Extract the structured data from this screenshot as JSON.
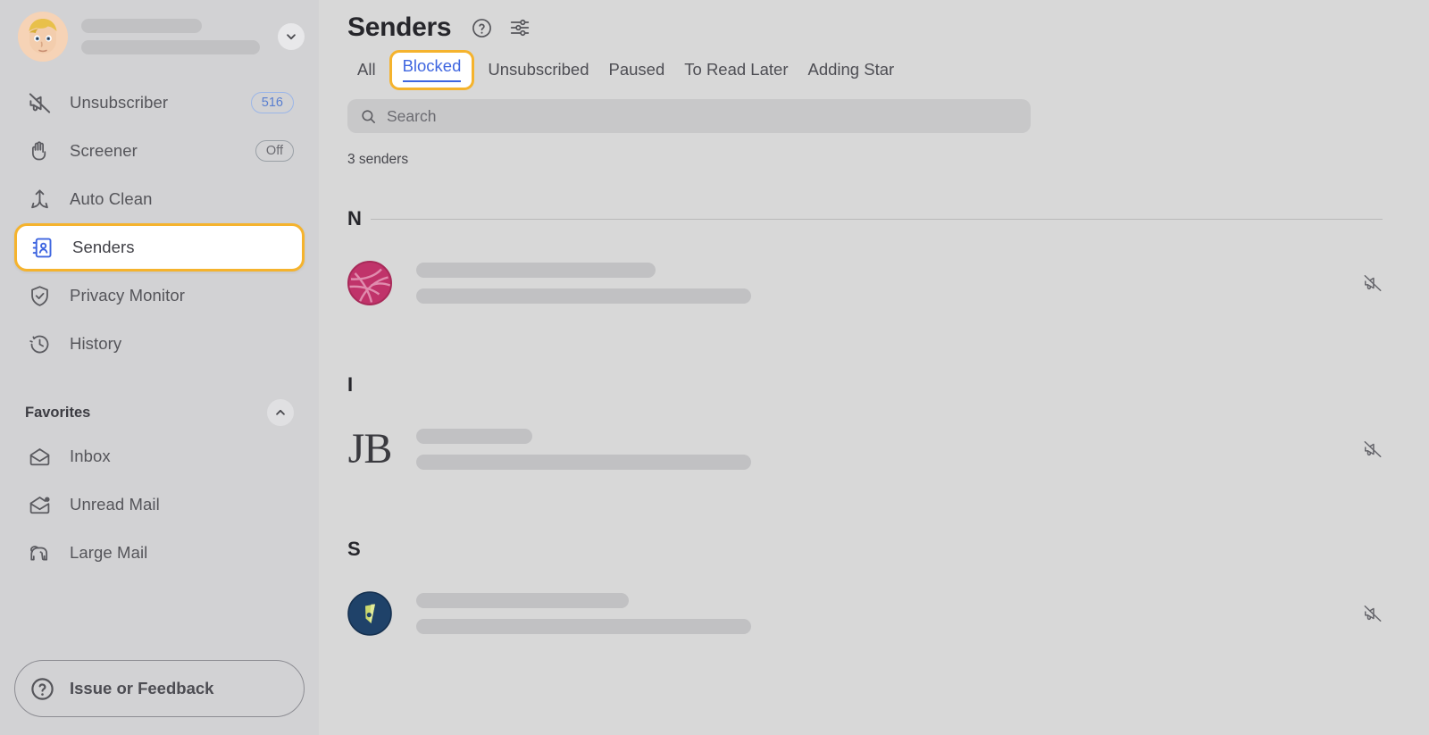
{
  "sidebar": {
    "account": {
      "name_redacted": true,
      "email_redacted": true,
      "avatar_icon": "memoji-avatar",
      "expand_icon": "chevron-down-icon"
    },
    "nav_items": [
      {
        "label": "Unsubscriber",
        "icon": "megaphone-slash-icon",
        "badge": "516",
        "badge_style": "blue",
        "active": false
      },
      {
        "label": "Screener",
        "icon": "hand-raised-icon",
        "badge": "Off",
        "badge_style": "gray",
        "active": false
      },
      {
        "label": "Auto Clean",
        "icon": "auto-clean-arrows-icon",
        "badge": "",
        "badge_style": "none",
        "active": false
      },
      {
        "label": "Senders",
        "icon": "contact-book-icon",
        "badge": "",
        "badge_style": "none",
        "active": true
      },
      {
        "label": "Privacy Monitor",
        "icon": "shield-check-icon",
        "badge": "",
        "badge_style": "none",
        "active": false
      },
      {
        "label": "History",
        "icon": "clock-history-icon",
        "badge": "",
        "badge_style": "none",
        "active": false
      }
    ],
    "favorites": {
      "title": "Favorites",
      "collapse_icon": "chevron-up-icon",
      "items": [
        {
          "label": "Inbox",
          "icon": "envelope-icon"
        },
        {
          "label": "Unread Mail",
          "icon": "envelope-dot-icon"
        },
        {
          "label": "Large Mail",
          "icon": "elephant-icon"
        }
      ]
    },
    "footer": {
      "feedback_label": "Issue or Feedback",
      "feedback_icon": "question-circle-icon"
    }
  },
  "main": {
    "title": "Senders",
    "help_icon": "question-circle-icon",
    "settings_icon": "sliders-icon",
    "tabs": [
      {
        "label": "All",
        "active": false
      },
      {
        "label": "Blocked",
        "active": true
      },
      {
        "label": "Unsubscribed",
        "active": false
      },
      {
        "label": "Paused",
        "active": false
      },
      {
        "label": "To Read Later",
        "active": false
      },
      {
        "label": "Adding Star",
        "active": false
      }
    ],
    "search": {
      "placeholder": "Search",
      "value": "",
      "icon": "search-icon"
    },
    "result_count": "3 senders",
    "groups": [
      {
        "letter": "N",
        "rule": true,
        "senders": [
          {
            "avatar_type": "dribbble-logo",
            "avatar_color": "#c0336a",
            "name_redacted": true,
            "email_redacted": true,
            "action_icon": "megaphone-slash-icon"
          }
        ]
      },
      {
        "letter": "I",
        "rule": false,
        "senders": [
          {
            "avatar_type": "text-monogram",
            "avatar_text": "JB",
            "avatar_color": "#3a3a3f",
            "name_redacted": true,
            "email_redacted": true,
            "action_icon": "megaphone-slash-icon"
          }
        ]
      },
      {
        "letter": "S",
        "rule": false,
        "senders": [
          {
            "avatar_type": "leaf-badge-logo",
            "avatar_color": "#1f4269",
            "avatar_accent": "#c9d66a",
            "name_redacted": true,
            "email_redacted": true,
            "action_icon": "megaphone-slash-icon"
          }
        ]
      }
    ]
  },
  "colors": {
    "highlight_ring": "#f5b32d",
    "accent_blue": "#3f66e0",
    "sidebar_bg": "#d2d2d4",
    "main_bg": "#d8d8d8",
    "redaction": "#c1c1c3"
  }
}
